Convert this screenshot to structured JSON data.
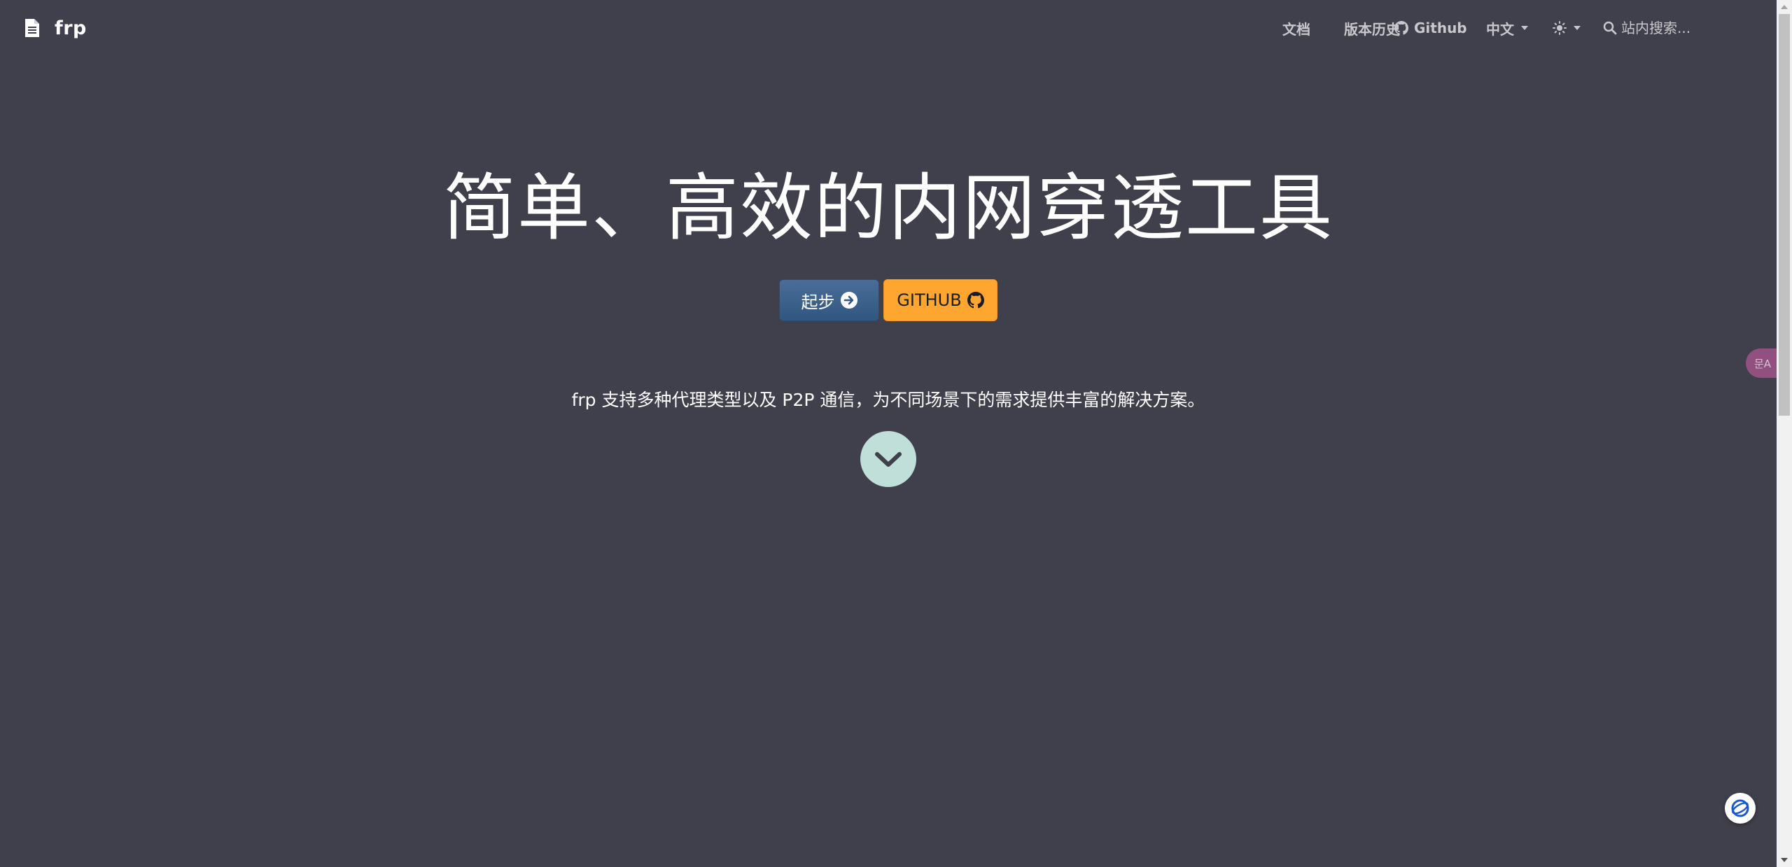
{
  "navbar": {
    "brand_name": "frp",
    "links": {
      "docs": "文档",
      "releases": "版本历史",
      "github": "Github",
      "language": "中文"
    },
    "search_placeholder": "站内搜索..."
  },
  "hero": {
    "title": "简单、高效的内网穿透工具",
    "primary_button": "起步",
    "secondary_button": "GITHUB",
    "tagline": "frp 支持多种代理类型以及 P2P 通信，为不同场景下的需求提供丰富的解决方案。"
  },
  "widgets": {
    "translate_label": "문A"
  },
  "colors": {
    "background": "#403f4c",
    "primary_button": "#30577f",
    "secondary_button": "#ffa630",
    "scroll_circle": "#c0dfd9",
    "nav_text": "#c8c8cc"
  },
  "icons": [
    "document-icon",
    "github-icon",
    "sun-icon",
    "search-icon",
    "arrow-right-circle-icon",
    "chevron-down-icon",
    "translate-icon",
    "chat-bubble-icon"
  ]
}
